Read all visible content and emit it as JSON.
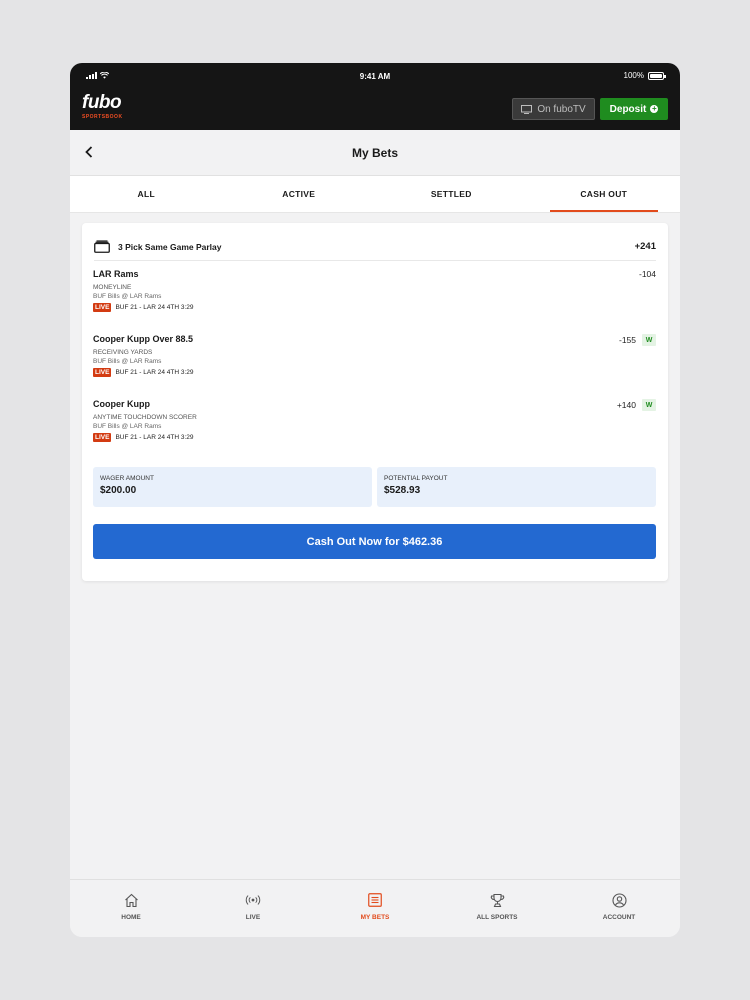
{
  "status_bar": {
    "time": "9:41 AM",
    "battery": "100%"
  },
  "app_bar": {
    "logo_word": "fubo",
    "logo_sub": "SPORTSBOOK",
    "on_tv_label": "On fuboTV",
    "deposit_label": "Deposit"
  },
  "header": {
    "title": "My Bets"
  },
  "tabs": [
    {
      "label": "ALL"
    },
    {
      "label": "ACTIVE"
    },
    {
      "label": "SETTLED"
    },
    {
      "label": "CASH OUT",
      "active": true
    }
  ],
  "bet": {
    "name": "3 Pick Same Game Parlay",
    "odds": "+241",
    "legs": [
      {
        "pick": "LAR Rams",
        "market": "MONEYLINE",
        "matchup": "BUF Bills @ LAR Rams",
        "live_label": "LIVE",
        "score": "BUF 21 - LAR 24 4TH 3:29",
        "odds": "-104",
        "result": ""
      },
      {
        "pick": "Cooper Kupp Over 88.5",
        "market": "RECEIVING YARDS",
        "matchup": "BUF Bills @ LAR Rams",
        "live_label": "LIVE",
        "score": "BUF 21 - LAR 24 4TH 3:29",
        "odds": "-155",
        "result": "W"
      },
      {
        "pick": "Cooper Kupp",
        "market": "ANYTIME TOUCHDOWN SCORER",
        "matchup": "BUF Bills @ LAR Rams",
        "live_label": "LIVE",
        "score": "BUF 21 - LAR 24 4TH 3:29",
        "odds": "+140",
        "result": "W"
      }
    ],
    "wager_label": "WAGER AMOUNT",
    "wager_value": "$200.00",
    "payout_label": "POTENTIAL PAYOUT",
    "payout_value": "$528.93",
    "cashout_label": "Cash Out Now for $462.36"
  },
  "bottom_nav": [
    {
      "label": "HOME",
      "icon": "home-icon"
    },
    {
      "label": "LIVE",
      "icon": "broadcast-icon"
    },
    {
      "label": "MY BETS",
      "icon": "bets-list-icon",
      "active": true
    },
    {
      "label": "ALL SPORTS",
      "icon": "trophy-icon"
    },
    {
      "label": "ACCOUNT",
      "icon": "user-circle-icon"
    }
  ],
  "colors": {
    "accent": "#e24b1c",
    "primary_button": "#2369d1",
    "deposit": "#1f8c1f",
    "live": "#d33b12"
  }
}
